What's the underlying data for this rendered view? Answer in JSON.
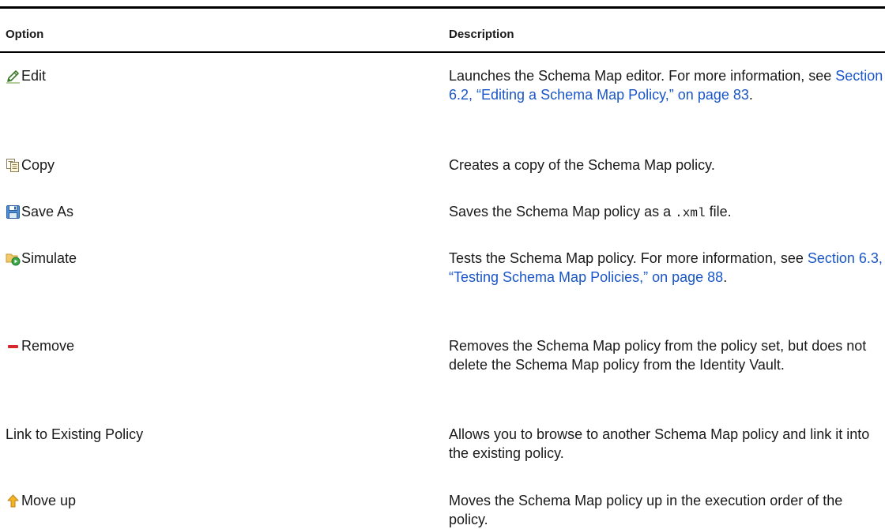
{
  "table": {
    "headers": {
      "option": "Option",
      "description": "Description"
    },
    "rows": [
      {
        "icon": "pencil-edit-icon",
        "option": "Edit",
        "desc_before": "Launches the Schema Map editor. For more information, see ",
        "desc_link": "Section 6.2, “Editing a Schema Map Policy,” on page 83",
        "desc_after": "."
      },
      {
        "icon": "copy-icon",
        "option": "Copy",
        "desc": "Creates a copy of the Schema Map policy."
      },
      {
        "icon": "save-as-icon",
        "option": "Save As",
        "desc_before": "Saves the Schema Map policy as a ",
        "desc_code": ".xml",
        "desc_after": " file."
      },
      {
        "icon": "simulate-icon",
        "option": "Simulate",
        "desc_before": "Tests the Schema Map policy. For more information, see ",
        "desc_link": "Section 6.3, “Testing Schema Map Policies,” on page 88",
        "desc_after": "."
      },
      {
        "icon": "remove-icon",
        "option": "Remove",
        "desc": "Removes the Schema Map policy from the policy set, but does not delete the Schema Map policy from the Identity Vault."
      },
      {
        "option": "Link to Existing Policy",
        "desc": "Allows you to browse to another Schema Map policy and link it into the existing policy."
      },
      {
        "icon": "arrow-up-icon",
        "option": "Move up",
        "desc": "Moves the Schema Map policy up in the execution order of the policy."
      }
    ]
  },
  "colors": {
    "link": "#1a56c8",
    "rule": "#000000",
    "text": "#1a1a1a"
  }
}
